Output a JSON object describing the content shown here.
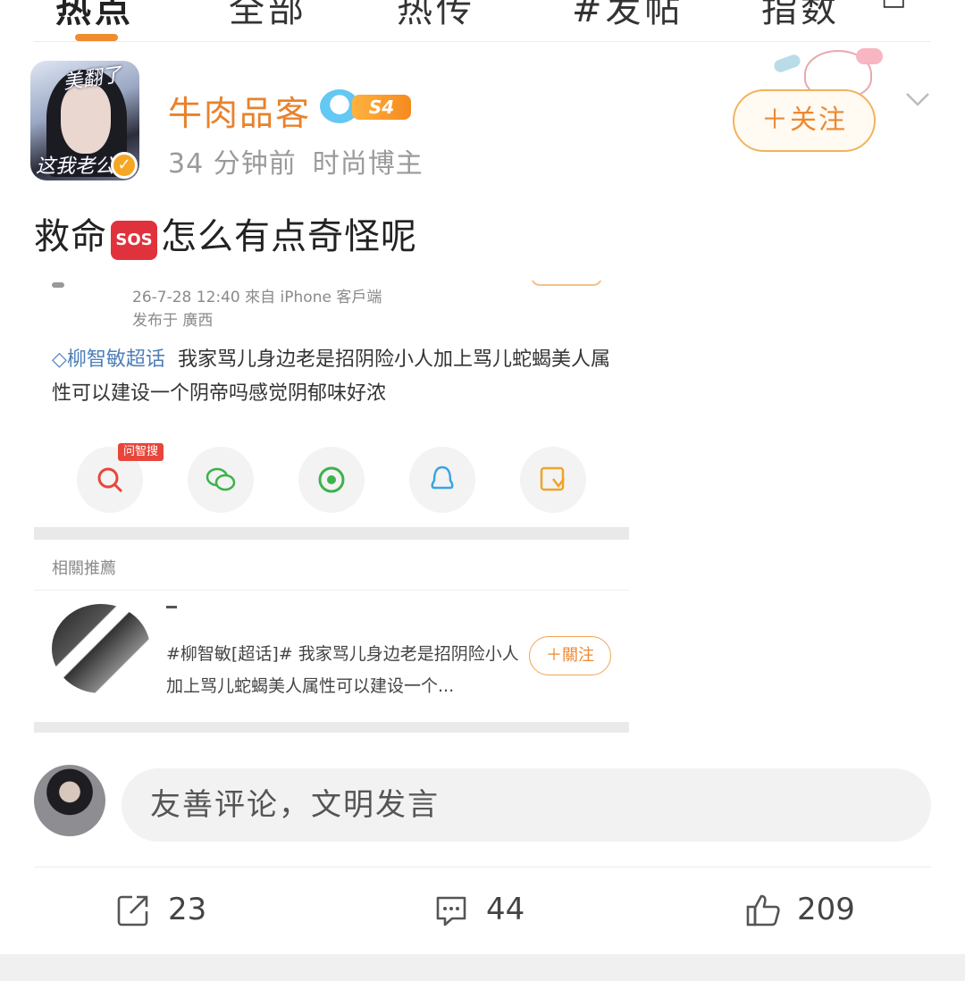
{
  "tabs": [
    "热点",
    "全部",
    "热传",
    "#发帖",
    "指数"
  ],
  "author": {
    "name": "牛肉品客",
    "level": "S4",
    "time": "34 分钟前",
    "tag": "时尚博主",
    "avatar_text_top": "美翻了",
    "avatar_text_bottom": "这我老公"
  },
  "follow_label": "＋关注",
  "post": {
    "before": "救命",
    "emoji": "SOS",
    "after": "怎么有点奇怪呢"
  },
  "embedded": {
    "date_line": "26-7-28 12:40  來自 iPhone 客戶端",
    "location": "发布于 廣西",
    "topic": "柳智敏超话",
    "body": "我家骂儿身边老是招阴险小人加上骂儿蛇蝎美人属性可以建设一个阴帝吗感觉阴郁味好浓",
    "share_tag": "问智搜",
    "share_icons": [
      "zhisou-search-icon",
      "wechat-icon",
      "moments-icon",
      "qq-icon",
      "save-image-icon"
    ],
    "related_label": "相關推薦",
    "related_text": "#柳智敏[超话]#  我家骂儿身边老是招阴险小人加上骂儿蛇蝎美人属性可以建设一个...",
    "related_follow": "＋關注"
  },
  "comment_placeholder": "友善评论，文明发言",
  "actions": {
    "repost": "23",
    "comment": "44",
    "like": "209"
  },
  "colors": {
    "accent": "#ee8830",
    "topic": "#4f7fb8",
    "sos": "#e0323c"
  }
}
